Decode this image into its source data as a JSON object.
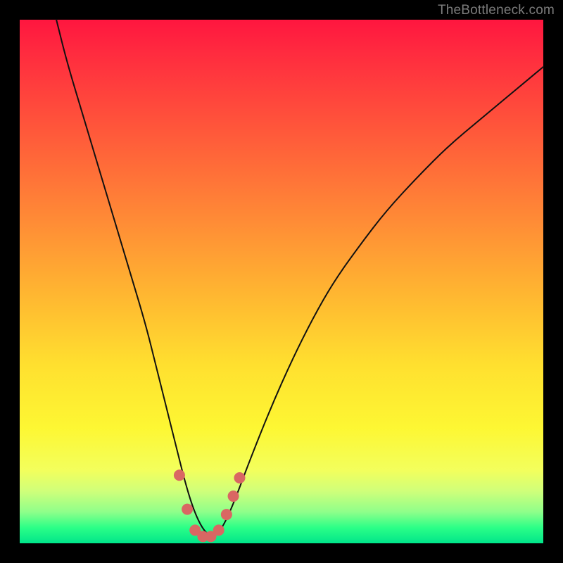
{
  "watermark": "TheBottleneck.com",
  "chart_data": {
    "type": "line",
    "title": "",
    "xlabel": "",
    "ylabel": "",
    "xlim": [
      0,
      100
    ],
    "ylim": [
      0,
      100
    ],
    "series": [
      {
        "name": "bottleneck-curve",
        "x": [
          7,
          9,
          12,
          15,
          18,
          21,
          24,
          26,
          28,
          30,
          31.5,
          33,
          34.5,
          36,
          37.5,
          39,
          41,
          44,
          48,
          52,
          56,
          60,
          65,
          70,
          76,
          82,
          88,
          94,
          100
        ],
        "y": [
          100,
          92,
          82,
          72,
          62,
          52,
          42,
          34,
          26,
          18,
          12,
          7,
          3.5,
          1.5,
          1.5,
          3.5,
          8,
          16,
          26,
          35,
          43,
          50,
          57,
          63.5,
          70,
          76,
          81,
          86,
          91
        ]
      }
    ],
    "markers": {
      "name": "highlight-points",
      "x": [
        30.5,
        32,
        33.5,
        35,
        36.5,
        38,
        39.5,
        40.8,
        42.0
      ],
      "y": [
        13,
        6.5,
        2.5,
        1.3,
        1.3,
        2.5,
        5.5,
        9,
        12.5
      ],
      "size": [
        8,
        8,
        8,
        8,
        8,
        8,
        8,
        8,
        8
      ]
    },
    "gradient_stops": [
      {
        "pos": 0,
        "color": "#ff163f"
      },
      {
        "pos": 22,
        "color": "#ff5a3a"
      },
      {
        "pos": 52,
        "color": "#ffb531"
      },
      {
        "pos": 78,
        "color": "#fdf733"
      },
      {
        "pos": 94,
        "color": "#8fff8a"
      },
      {
        "pos": 100,
        "color": "#00e58a"
      }
    ]
  }
}
